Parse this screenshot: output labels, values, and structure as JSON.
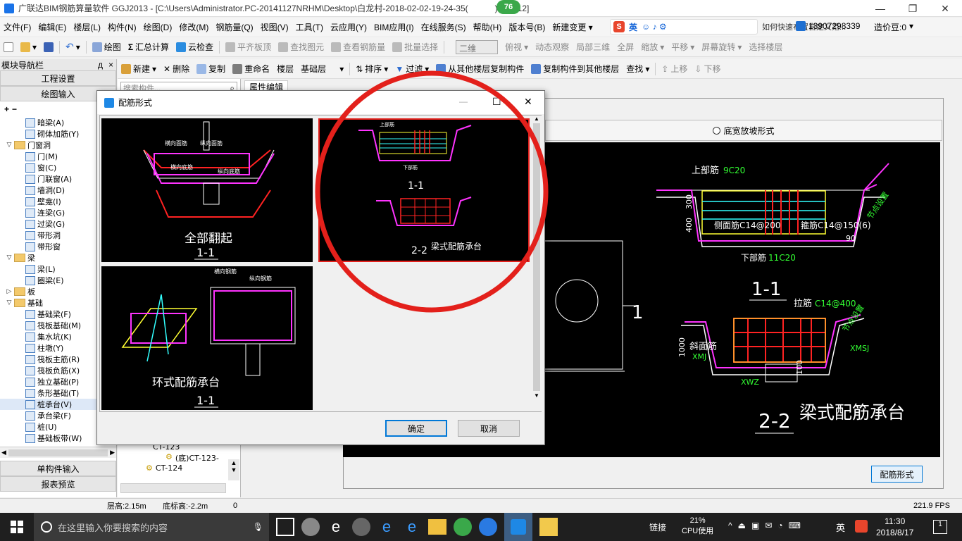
{
  "titlebar": {
    "title": "广联达BIM钢筋算量软件 GGJ2013 - [C:\\Users\\Administrator.PC-20141127NRHM\\Desktop\\白龙村-2018-02-02-19-24-35(",
    "title_suffix": ").GGJ12]",
    "badge": "76",
    "minimize": "—",
    "restore": "❐",
    "close": "✕"
  },
  "menubar": {
    "items": [
      "文件(F)",
      "编辑(E)",
      "楼层(L)",
      "构件(N)",
      "绘图(D)",
      "修改(M)",
      "钢筋量(Q)",
      "视图(V)",
      "工具(T)",
      "云应用(Y)",
      "BIM应用(I)",
      "在线服务(S)",
      "帮助(H)",
      "版本号(B)",
      "新建变更 ▾"
    ],
    "ime_label": "英",
    "notice": "如何快速布置自定义范...",
    "phone": "13907298339",
    "cost_beans": "造价豆:0"
  },
  "toolbar1": {
    "items": [
      "绘图",
      "汇总计算",
      "云检查",
      "平齐板顶",
      "查找图元",
      "查看钢筋量",
      "批量选择"
    ],
    "view_mode": "二维",
    "items2": [
      "俯视",
      "动态观察",
      "局部三维",
      "全屏",
      "缩放",
      "平移",
      "屏幕旋转",
      "选择楼层"
    ]
  },
  "toolbar2": {
    "items": [
      "新建",
      "删除",
      "复制",
      "重命名",
      "楼层",
      "基础层"
    ],
    "items2": [
      "排序",
      "过滤",
      "从其他楼层复制构件",
      "复制构件到其他楼层",
      "查找",
      "上移",
      "下移"
    ]
  },
  "leftpanel": {
    "header": "模块导航栏",
    "pin": "д",
    "close": "×",
    "btn_project": "工程设置",
    "btn_draw": "绘图输入",
    "tree": [
      {
        "label": "暗梁(A)",
        "level": 2,
        "type": "item"
      },
      {
        "label": "砌体加筋(Y)",
        "level": 2,
        "type": "item"
      },
      {
        "label": "门窗洞",
        "level": 1,
        "type": "folder",
        "expanded": true
      },
      {
        "label": "门(M)",
        "level": 2,
        "type": "item"
      },
      {
        "label": "窗(C)",
        "level": 2,
        "type": "item"
      },
      {
        "label": "门联窗(A)",
        "level": 2,
        "type": "item"
      },
      {
        "label": "墙洞(D)",
        "level": 2,
        "type": "item"
      },
      {
        "label": "壁龛(I)",
        "level": 2,
        "type": "item"
      },
      {
        "label": "连梁(G)",
        "level": 2,
        "type": "item"
      },
      {
        "label": "过梁(G)",
        "level": 2,
        "type": "item"
      },
      {
        "label": "带形洞",
        "level": 2,
        "type": "item"
      },
      {
        "label": "带形窗",
        "level": 2,
        "type": "item"
      },
      {
        "label": "梁",
        "level": 1,
        "type": "folder",
        "expanded": true
      },
      {
        "label": "梁(L)",
        "level": 2,
        "type": "item"
      },
      {
        "label": "圈梁(E)",
        "level": 2,
        "type": "item"
      },
      {
        "label": "板",
        "level": 1,
        "type": "folder",
        "expanded": false
      },
      {
        "label": "基础",
        "level": 1,
        "type": "folder",
        "expanded": true
      },
      {
        "label": "基础梁(F)",
        "level": 2,
        "type": "item"
      },
      {
        "label": "筏板基础(M)",
        "level": 2,
        "type": "item"
      },
      {
        "label": "集水坑(K)",
        "level": 2,
        "type": "item"
      },
      {
        "label": "柱墩(Y)",
        "level": 2,
        "type": "item"
      },
      {
        "label": "筏板主筋(R)",
        "level": 2,
        "type": "item"
      },
      {
        "label": "筏板负筋(X)",
        "level": 2,
        "type": "item"
      },
      {
        "label": "独立基础(P)",
        "level": 2,
        "type": "item"
      },
      {
        "label": "条形基础(T)",
        "level": 2,
        "type": "item"
      },
      {
        "label": "桩承台(V)",
        "level": 2,
        "type": "item",
        "selected": true
      },
      {
        "label": "承台梁(F)",
        "level": 2,
        "type": "item"
      },
      {
        "label": "桩(U)",
        "level": 2,
        "type": "item"
      },
      {
        "label": "基础板带(W)",
        "level": 2,
        "type": "item"
      }
    ],
    "btn_single": "单构件输入",
    "btn_report": "报表预览"
  },
  "midpanel": {
    "search_placeholder": "搜索构件...",
    "rows": [
      "CT-123",
      "(底)CT-123-",
      "CT-124"
    ]
  },
  "rightarea": {
    "tab": "属性编辑",
    "radio_label": "底宽放坡形式",
    "btn_rebar_form": "配筋形式",
    "cad": {
      "top_rebar": "上部筋",
      "top_rebar_spec": "9C20",
      "side_rebar": "侧面筋C14@200",
      "stirrup": "箍筋C14@150(6)",
      "bottom_rebar": "下部筋",
      "bottom_rebar_spec": "11C20",
      "dim300": "300",
      "dim400": "400",
      "dim1000": "1000",
      "dim100": "100",
      "slope_note": "节点设置",
      "angle": "90",
      "section1": "1-1",
      "tie": "拉筋",
      "tie_spec": "C14@400",
      "slope_bar": "斜面筋",
      "xmj": "XMJ",
      "xmsj": "XMSJ",
      "xwz": "XWZ",
      "section2": "2-2",
      "title": "梁式配筋承台",
      "plan_mark": "1"
    }
  },
  "dialog": {
    "title": "配筋形式",
    "minimize": "—",
    "maximize": "☐",
    "close": "✕",
    "thumbs": [
      {
        "title": "全部翻起",
        "section": "1-1",
        "l1": "横向面筋",
        "l2": "纵向面筋",
        "l3": "横向底筋",
        "l4": "纵向底筋"
      },
      {
        "title": "梁式配筋承台",
        "section": "2-2",
        "section_top": "1-1",
        "l1": "上部筋",
        "l2": "下部筋"
      },
      {
        "title": "环式配筋承台",
        "section": "1-1",
        "l1": "横向钢筋",
        "l2": "纵向钢筋"
      }
    ],
    "ok": "确定",
    "cancel": "取消"
  },
  "statusbar": {
    "floor_height": "层高:2.15m",
    "bottom_elev": "底标高:-2.2m",
    "zero": "0",
    "fps": "221.9 FPS"
  },
  "taskbar": {
    "search_placeholder": "在这里输入你要搜索的内容",
    "link": "链接",
    "cpu_percent": "21%",
    "cpu_label": "CPU使用",
    "ime": "英",
    "time": "11:30",
    "date": "2018/8/17",
    "notif_count": "1"
  },
  "colors": {
    "highlight_red": "#e3201b",
    "cad_green": "#33ff33",
    "cad_magenta": "#ff33ff",
    "cad_yellow": "#ffff33",
    "cad_cyan": "#33ffff",
    "taskbar_bg": "#1f1f1f"
  }
}
